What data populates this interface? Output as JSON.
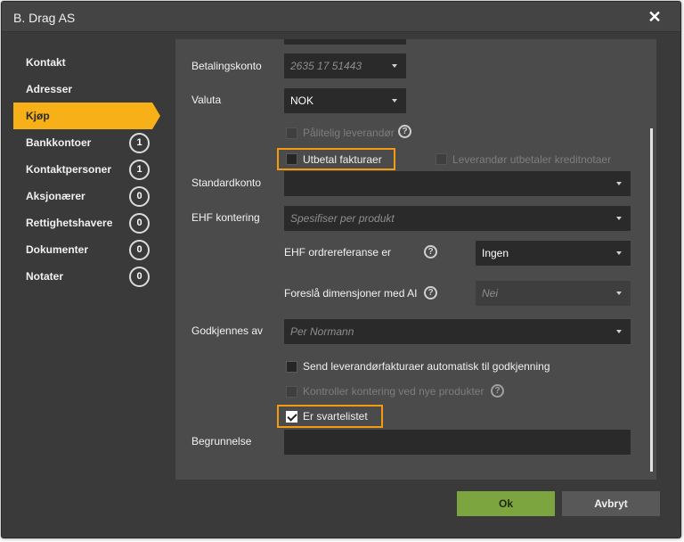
{
  "window": {
    "title": "B. Drag AS"
  },
  "nav": {
    "items": [
      {
        "label": "Kontakt"
      },
      {
        "label": "Adresser"
      },
      {
        "label": "Kjøp"
      },
      {
        "label": "Bankkontoer",
        "count": "1"
      },
      {
        "label": "Kontaktpersoner",
        "count": "1"
      },
      {
        "label": "Aksjonærer",
        "count": "0"
      },
      {
        "label": "Rettighetshavere",
        "count": "0"
      },
      {
        "label": "Dokumenter",
        "count": "0"
      },
      {
        "label": "Notater",
        "count": "0"
      }
    ],
    "active_index": 2
  },
  "form": {
    "betalingskonto": {
      "label": "Betalingskonto",
      "value": "2635 17 51443"
    },
    "valuta": {
      "label": "Valuta",
      "value": "NOK"
    },
    "palitelig": {
      "label": "Pålitelig leverandør"
    },
    "utbetal": {
      "label": "Utbetal fakturaer"
    },
    "kreditnotaer": {
      "label": "Leverandør utbetaler kreditnotaer"
    },
    "standardkonto": {
      "label": "Standardkonto",
      "value": ""
    },
    "ehf_kontering": {
      "label": "EHF kontering",
      "placeholder": "Spesifiser per produkt"
    },
    "ehf_ordrereferanse": {
      "label": "EHF ordrereferanse er",
      "value": "Ingen"
    },
    "foresla_dimensjoner": {
      "label": "Foreslå dimensjoner med AI",
      "value": "Nei"
    },
    "godkjennes_av": {
      "label": "Godkjennes av",
      "placeholder": "Per Normann"
    },
    "send_godkjenning": {
      "label": "Send leverandørfakturaer automatisk til godkjenning"
    },
    "kontroller": {
      "label": "Kontroller kontering ved nye produkter"
    },
    "svartelistet": {
      "label": "Er svartelistet",
      "checked": true
    },
    "begrunnelse": {
      "label": "Begrunnelse",
      "value": ""
    }
  },
  "buttons": {
    "ok": "Ok",
    "cancel": "Avbryt"
  },
  "colors": {
    "accent": "#f7b017",
    "highlight": "#f39c12",
    "ok": "#7ca540"
  }
}
